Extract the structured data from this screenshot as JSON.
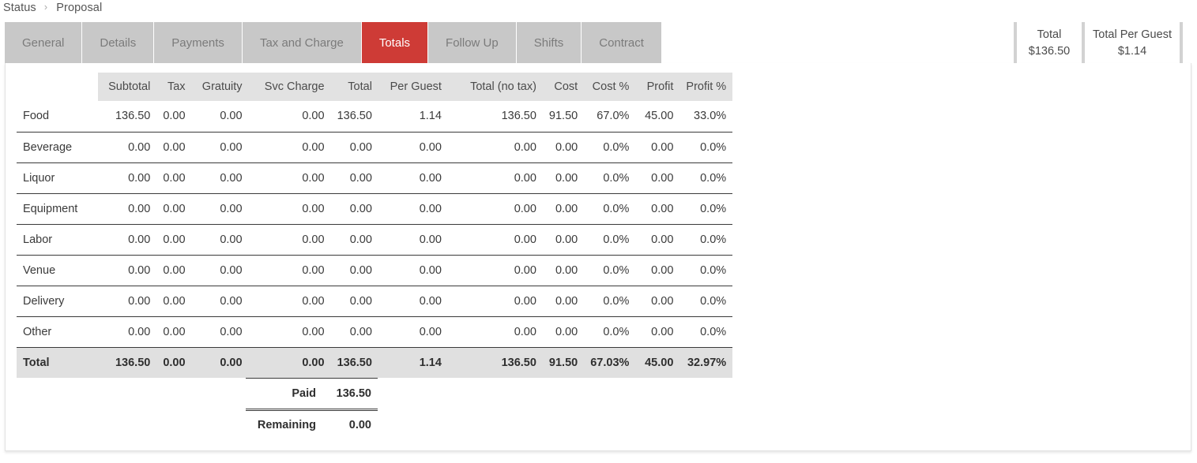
{
  "breadcrumb": {
    "items": [
      "Status",
      "Proposal"
    ],
    "separator": "›"
  },
  "tabs": [
    {
      "label": "General",
      "active": false
    },
    {
      "label": "Details",
      "active": false
    },
    {
      "label": "Payments",
      "active": false
    },
    {
      "label": "Tax and Charge",
      "active": false
    },
    {
      "label": "Totals",
      "active": true
    },
    {
      "label": "Follow Up",
      "active": false
    },
    {
      "label": "Shifts",
      "active": false
    },
    {
      "label": "Contract",
      "active": false
    }
  ],
  "colors": {
    "active_tab_bg": "#ce3b36",
    "tab_bg": "#c8c8c8",
    "header_bg": "#e2e2e2",
    "total_row_bg": "#e0e0e0"
  },
  "summary": [
    {
      "label": "Total",
      "value": "$136.50"
    },
    {
      "label": "Total Per Guest",
      "value": "$1.14"
    }
  ],
  "table": {
    "columns": [
      "",
      "Subtotal",
      "Tax",
      "Gratuity",
      "Svc Charge",
      "Total",
      "Per Guest",
      "Total (no tax)",
      "Cost",
      "Cost %",
      "Profit",
      "Profit %"
    ],
    "rows": [
      {
        "label": "Food",
        "cells": [
          "136.50",
          "0.00",
          "0.00",
          "0.00",
          "136.50",
          "1.14",
          "136.50",
          "91.50",
          "67.0%",
          "45.00",
          "33.0%"
        ]
      },
      {
        "label": "Beverage",
        "cells": [
          "0.00",
          "0.00",
          "0.00",
          "0.00",
          "0.00",
          "0.00",
          "0.00",
          "0.00",
          "0.0%",
          "0.00",
          "0.0%"
        ]
      },
      {
        "label": "Liquor",
        "cells": [
          "0.00",
          "0.00",
          "0.00",
          "0.00",
          "0.00",
          "0.00",
          "0.00",
          "0.00",
          "0.0%",
          "0.00",
          "0.0%"
        ]
      },
      {
        "label": "Equipment",
        "cells": [
          "0.00",
          "0.00",
          "0.00",
          "0.00",
          "0.00",
          "0.00",
          "0.00",
          "0.00",
          "0.0%",
          "0.00",
          "0.0%"
        ]
      },
      {
        "label": "Labor",
        "cells": [
          "0.00",
          "0.00",
          "0.00",
          "0.00",
          "0.00",
          "0.00",
          "0.00",
          "0.00",
          "0.0%",
          "0.00",
          "0.0%"
        ]
      },
      {
        "label": "Venue",
        "cells": [
          "0.00",
          "0.00",
          "0.00",
          "0.00",
          "0.00",
          "0.00",
          "0.00",
          "0.00",
          "0.0%",
          "0.00",
          "0.0%"
        ]
      },
      {
        "label": "Delivery",
        "cells": [
          "0.00",
          "0.00",
          "0.00",
          "0.00",
          "0.00",
          "0.00",
          "0.00",
          "0.00",
          "0.0%",
          "0.00",
          "0.0%"
        ]
      },
      {
        "label": "Other",
        "cells": [
          "0.00",
          "0.00",
          "0.00",
          "0.00",
          "0.00",
          "0.00",
          "0.00",
          "0.00",
          "0.0%",
          "0.00",
          "0.0%"
        ]
      }
    ],
    "total_row": {
      "label": "Total",
      "cells": [
        "136.50",
        "0.00",
        "0.00",
        "0.00",
        "136.50",
        "1.14",
        "136.50",
        "91.50",
        "67.03%",
        "45.00",
        "32.97%"
      ]
    }
  },
  "payments": [
    {
      "label": "Paid",
      "value": "136.50"
    },
    {
      "label": "Remaining",
      "value": "0.00"
    }
  ]
}
